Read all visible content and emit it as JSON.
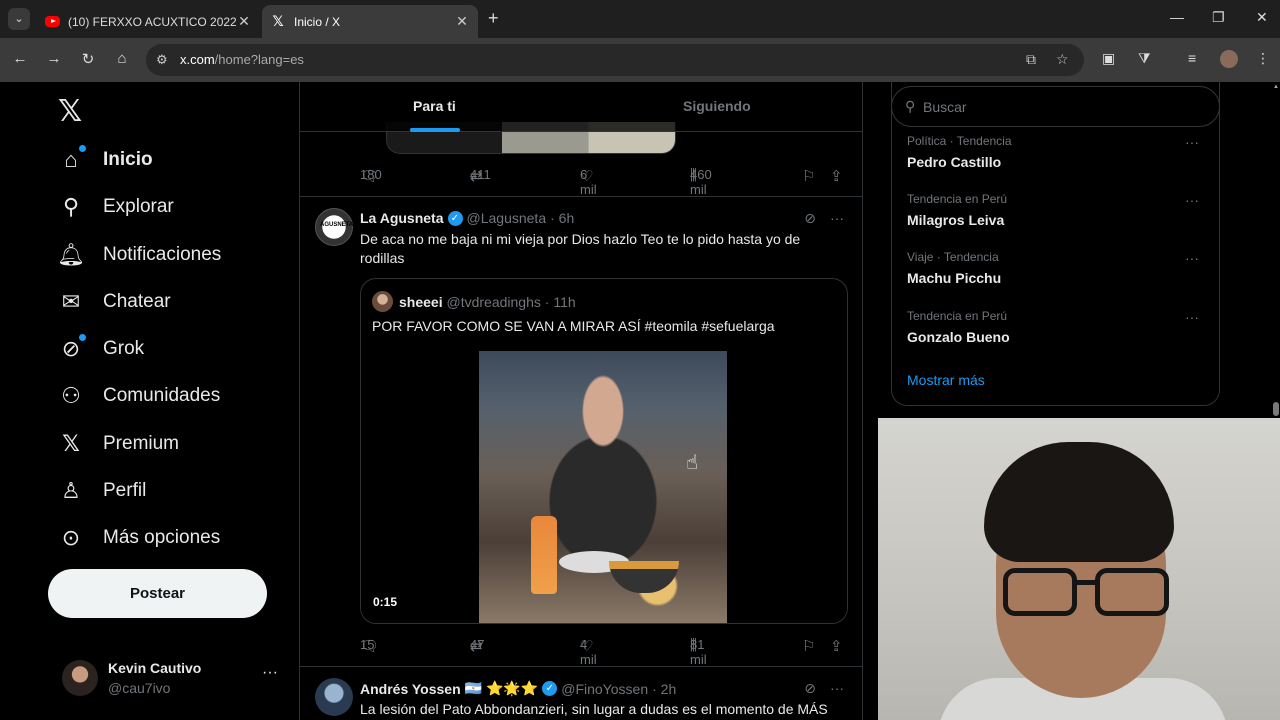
{
  "browser": {
    "tabs": [
      {
        "title": "(10) FERXXO ACUXTICO 2022 (",
        "icon": "youtube-icon"
      },
      {
        "title": "Inicio / X",
        "icon": "x-icon"
      }
    ],
    "url_host": "x.com",
    "url_rest": "/home?lang=es"
  },
  "sidebar": {
    "items": [
      {
        "label": "Inicio",
        "icon": "home-icon"
      },
      {
        "label": "Explorar",
        "icon": "search-icon"
      },
      {
        "label": "Notificaciones",
        "icon": "bell-icon"
      },
      {
        "label": "Chatear",
        "icon": "mail-icon"
      },
      {
        "label": "Grok",
        "icon": "grok-icon"
      },
      {
        "label": "Comunidades",
        "icon": "people-icon"
      },
      {
        "label": "Premium",
        "icon": "x-icon"
      },
      {
        "label": "Perfil",
        "icon": "person-icon"
      },
      {
        "label": "Más opciones",
        "icon": "more-circle-icon"
      }
    ],
    "post_label": "Postear",
    "account": {
      "name": "Kevin Cautivo",
      "handle": "@cau7ivo"
    }
  },
  "timeline": {
    "tabs": [
      "Para ti",
      "Siguiendo"
    ],
    "prev_actions": {
      "replies": "180",
      "reposts": "411",
      "likes": "6 mil",
      "views": "460 mil"
    },
    "tweet1": {
      "name": "La Agusneta",
      "handle": "@Lagusneta",
      "time": "· 6h",
      "text": "De aca no me baja ni mi vieja por Dios hazlo Teo te lo pido hasta yo de rodillas",
      "quote": {
        "name": "sheeei",
        "handle": "@tvdreadinghs",
        "time": "· 11h",
        "text": "POR FAVOR COMO SE VAN A MIRAR ASÍ #teomila #sefuelarga",
        "video_time": "0:15"
      },
      "actions": {
        "replies": "15",
        "reposts": "47",
        "likes": "4 mil",
        "views": "81 mil"
      }
    },
    "tweet2": {
      "name": "Andrés Yossen",
      "emoji": "🇦🇷 ⭐🌟⭐",
      "handle": "@FinoYossen",
      "time": "· 2h",
      "text": "La lesión del Pato Abbondanzieri, sin lugar a dudas es el momento de MÁS"
    }
  },
  "right": {
    "search_placeholder": "Buscar",
    "trends": [
      {
        "meta": "Política · Tendencia",
        "name": "Pedro Castillo"
      },
      {
        "meta": "Tendencia en Perú",
        "name": "Milagros Leiva"
      },
      {
        "meta": "Viaje · Tendencia",
        "name": "Machu Picchu"
      },
      {
        "meta": "Tendencia en Perú",
        "name": "Gonzalo Bueno"
      }
    ],
    "show_more": "Mostrar más"
  },
  "colors": {
    "accent": "#1d9bf0",
    "background": "#000000",
    "border": "#2f3336",
    "muted": "#71767b"
  }
}
